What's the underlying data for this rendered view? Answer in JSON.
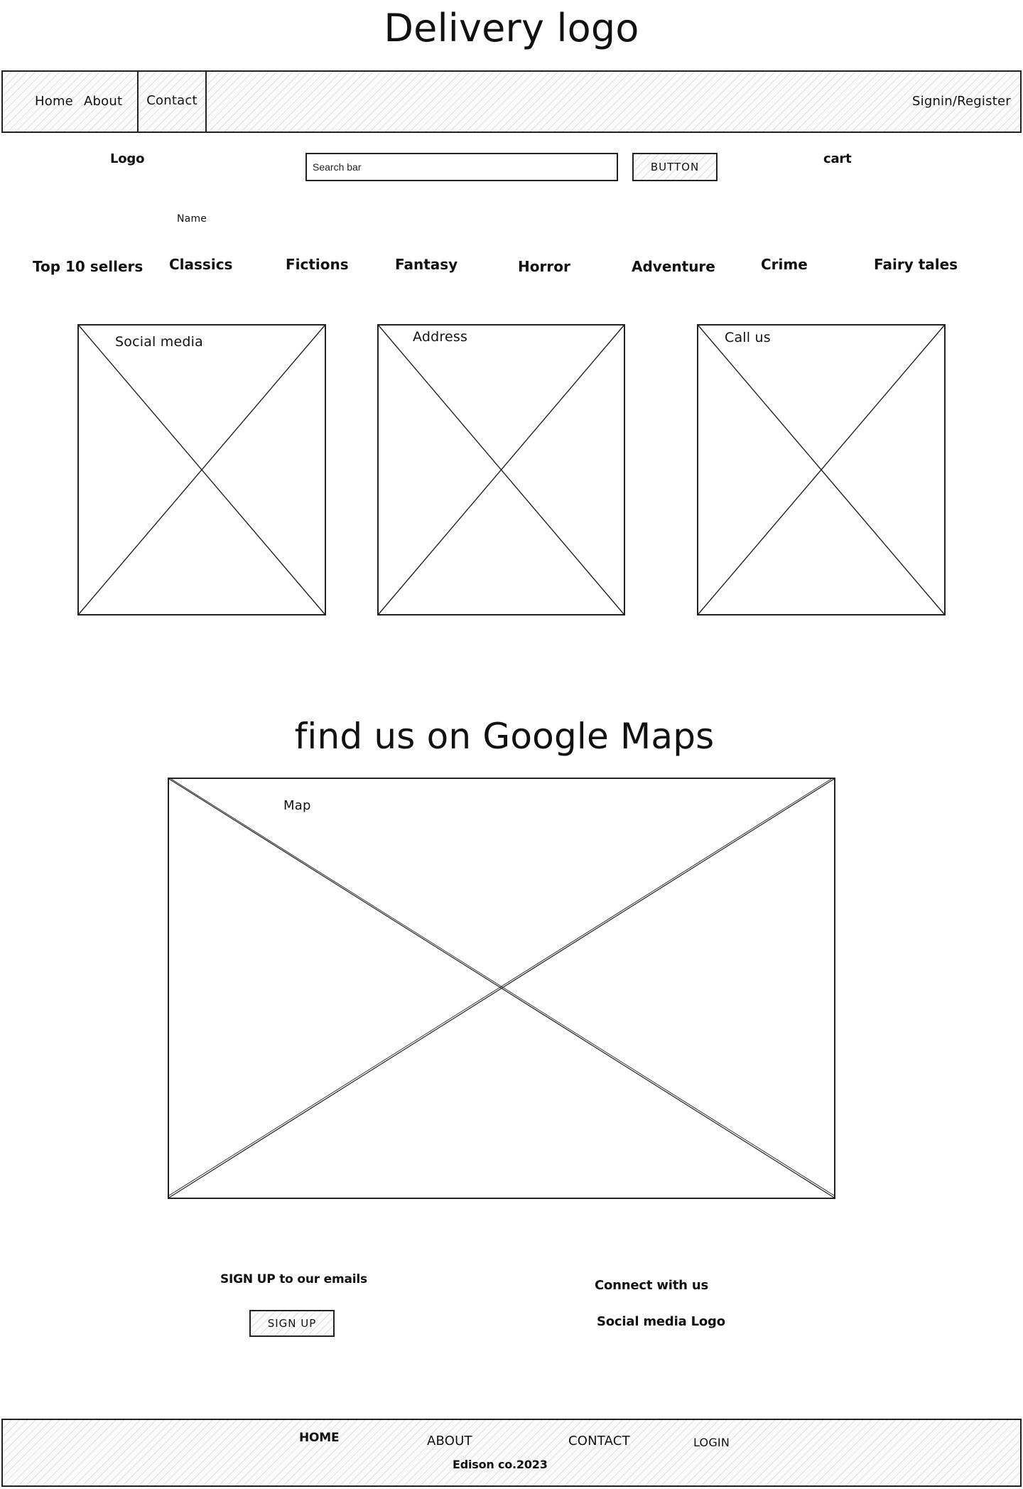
{
  "header": {
    "logo_title": "Delivery logo"
  },
  "top_nav": {
    "home": "Home",
    "about": "About",
    "contact": "Contact",
    "signin": "Signin/Register"
  },
  "toolbar": {
    "logo": "Logo",
    "search_placeholder": "Search bar",
    "button_label": "BUTTON",
    "cart": "cart"
  },
  "name_label": "Name",
  "categories": [
    "Top 10 sellers",
    "Classics",
    "Fictions",
    "Fantasy",
    "Horror",
    "Adventure",
    "Crime",
    "Fairy tales"
  ],
  "cards": [
    "Social media",
    "Address",
    "Call us"
  ],
  "map_section": {
    "title": "find us on Google Maps",
    "map_label": "Map"
  },
  "signup": {
    "text": "SIGN UP to our emails",
    "button_label": "SIGN UP"
  },
  "connect": {
    "title": "Connect with us",
    "social_logo": "Social media Logo"
  },
  "footer": {
    "home": "HOME",
    "about": "ABOUT",
    "contact": "CONTACT",
    "login": "LOGIN",
    "copyright": "Edison co.2023"
  }
}
